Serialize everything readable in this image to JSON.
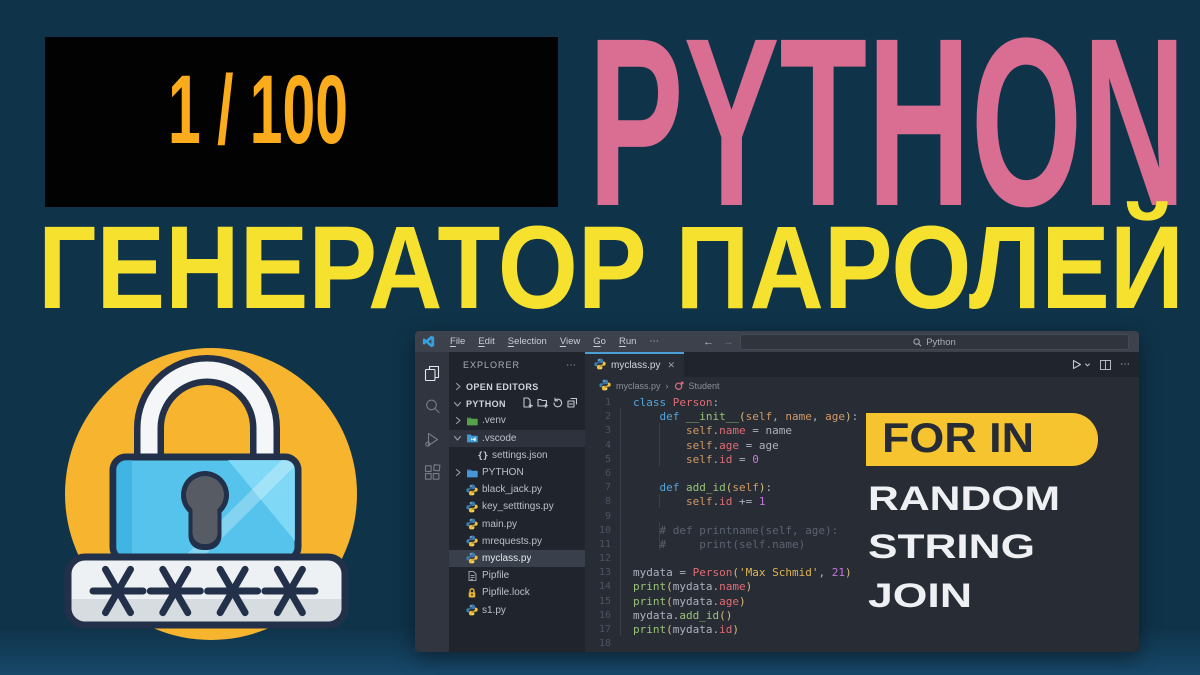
{
  "page": {
    "background": "#0f3349"
  },
  "counter": {
    "value": "1 / 100"
  },
  "headline": {
    "title": "PYTHON",
    "subtitle": "ГЕНЕРАТОР ПАРОЛЕЙ"
  },
  "colors": {
    "counter_text": "#fbac1d",
    "counter_bg": "#020202",
    "title": "#d96d92",
    "subtitle": "#f6e22e",
    "topic_pill": "#f6c42f",
    "topic_text": "#eef0f3",
    "circle": "#f6b42f",
    "lock_body": "#55c3ec",
    "tab_accent": "#4d9fd8"
  },
  "lock_art": {
    "password_mask": "****"
  },
  "topics": {
    "highlight": "FOR IN",
    "items": [
      "RANDOM",
      "STRING",
      "JOIN"
    ]
  },
  "vscode": {
    "menus": [
      "File",
      "Edit",
      "Selection",
      "View",
      "Go",
      "Run",
      "⋯"
    ],
    "nav": {
      "back": "←",
      "forward": "→"
    },
    "search": {
      "value": "Python"
    },
    "activity_bar": [
      "explorer",
      "search",
      "run-debug",
      "extensions"
    ],
    "explorer": {
      "header": "EXPLORER",
      "header_more": "⋯",
      "items": [
        {
          "label": "OPEN EDITORS",
          "kind": "section",
          "chevron": "right"
        },
        {
          "label": "PYTHON",
          "kind": "section",
          "chevron": "down",
          "actions": [
            "new-file",
            "new-folder",
            "refresh",
            "collapse"
          ]
        },
        {
          "label": ".venv",
          "icon": "folder-green",
          "chevron": "right"
        },
        {
          "label": ".vscode",
          "icon": "folder-vscode",
          "chevron": "down",
          "highlighted": true
        },
        {
          "label": "settings.json",
          "icon": "braces",
          "indent": 1
        },
        {
          "label": "PYTHON",
          "icon": "folder-blue",
          "chevron": "right"
        },
        {
          "label": "black_jack.py",
          "icon": "python"
        },
        {
          "label": "key_setttings.py",
          "icon": "python"
        },
        {
          "label": "main.py",
          "icon": "python"
        },
        {
          "label": "mrequests.py",
          "icon": "python"
        },
        {
          "label": "myclass.py",
          "icon": "python",
          "selected": true
        },
        {
          "label": "Pipfile",
          "icon": "file"
        },
        {
          "label": "Pipfile.lock",
          "icon": "lock"
        },
        {
          "label": "s1.py",
          "icon": "python"
        }
      ]
    },
    "tab": {
      "label": "myclass.py",
      "close": "✕"
    },
    "breadcrumb": {
      "file": "myclass.py",
      "separator": "›",
      "symbol": "Student"
    },
    "code": {
      "lines": [
        [
          [
            "kw",
            "class"
          ],
          [
            "d",
            " "
          ],
          [
            "cls",
            "Person"
          ],
          [
            "d",
            ":"
          ]
        ],
        [
          [
            "d",
            "    "
          ],
          [
            "kw",
            "def"
          ],
          [
            "d",
            " "
          ],
          [
            "fn",
            "__init__"
          ],
          [
            "pa",
            "("
          ],
          [
            "slf",
            "self"
          ],
          [
            "d",
            ", "
          ],
          [
            "slf",
            "name"
          ],
          [
            "d",
            ", "
          ],
          [
            "slf",
            "age"
          ],
          [
            "pa",
            ")"
          ],
          [
            "d",
            ":"
          ]
        ],
        [
          [
            "d",
            "        "
          ],
          [
            "slf",
            "self"
          ],
          [
            "d",
            "."
          ],
          [
            "prop",
            "name"
          ],
          [
            "d",
            " = "
          ],
          [
            "d",
            "name"
          ]
        ],
        [
          [
            "d",
            "        "
          ],
          [
            "slf",
            "self"
          ],
          [
            "d",
            "."
          ],
          [
            "prop",
            "age"
          ],
          [
            "d",
            " = "
          ],
          [
            "d",
            "age"
          ]
        ],
        [
          [
            "d",
            "        "
          ],
          [
            "slf",
            "self"
          ],
          [
            "d",
            "."
          ],
          [
            "prop",
            "id"
          ],
          [
            "d",
            " = "
          ],
          [
            "num",
            "0"
          ]
        ],
        [],
        [
          [
            "d",
            "    "
          ],
          [
            "kw",
            "def"
          ],
          [
            "d",
            " "
          ],
          [
            "fn",
            "add_id"
          ],
          [
            "pa",
            "("
          ],
          [
            "slf",
            "self"
          ],
          [
            "pa",
            ")"
          ],
          [
            "d",
            ":"
          ]
        ],
        [
          [
            "d",
            "        "
          ],
          [
            "slf",
            "self"
          ],
          [
            "d",
            "."
          ],
          [
            "prop",
            "id"
          ],
          [
            "d",
            " "
          ],
          [
            "op",
            "+="
          ],
          [
            "d",
            " "
          ],
          [
            "num",
            "1"
          ]
        ],
        [],
        [
          [
            "com",
            "    # def printname(self, age):"
          ]
        ],
        [
          [
            "com",
            "    #     print(self.name)"
          ]
        ],
        [],
        [
          [
            "d",
            "mydata"
          ],
          [
            "d",
            " = "
          ],
          [
            "cls",
            "Person"
          ],
          [
            "pa",
            "("
          ],
          [
            "str",
            "'Max Schmid'"
          ],
          [
            "d",
            ", "
          ],
          [
            "num",
            "21"
          ],
          [
            "pa",
            ")"
          ]
        ],
        [
          [
            "fn",
            "print"
          ],
          [
            "pa",
            "("
          ],
          [
            "d",
            "mydata"
          ],
          [
            "d",
            "."
          ],
          [
            "prop",
            "name"
          ],
          [
            "pa",
            ")"
          ]
        ],
        [
          [
            "fn",
            "print"
          ],
          [
            "pa",
            "("
          ],
          [
            "d",
            "mydata"
          ],
          [
            "d",
            "."
          ],
          [
            "prop",
            "age"
          ],
          [
            "pa",
            ")"
          ]
        ],
        [
          [
            "d",
            "mydata"
          ],
          [
            "d",
            "."
          ],
          [
            "fn",
            "add_id"
          ],
          [
            "pa",
            "("
          ],
          [
            "pa",
            ")"
          ]
        ],
        [
          [
            "fn",
            "print"
          ],
          [
            "pa",
            "("
          ],
          [
            "d",
            "mydata"
          ],
          [
            "d",
            "."
          ],
          [
            "prop",
            "id"
          ],
          [
            "pa",
            ")"
          ]
        ],
        []
      ]
    }
  }
}
